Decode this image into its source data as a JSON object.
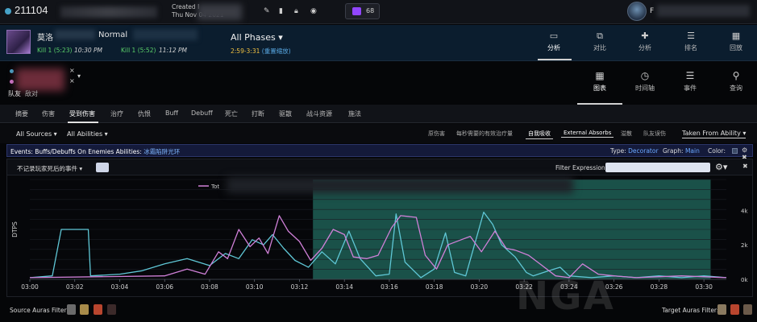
{
  "header": {
    "report_id": "211104",
    "created_label": "Created l",
    "created_date": "Thu Nov 04 2021",
    "twitch_count": "68",
    "user_initial": "F",
    "icons": [
      "pencil-icon",
      "trash-icon",
      "lock-icon",
      "eye-slash-icon",
      "twitch-icon"
    ]
  },
  "boss": {
    "name": "莫洛",
    "difficulty": "Normal",
    "kill_left": "Kill 1 (5:23)",
    "kill_left_time": "10:30 PM",
    "kill_right": "Kill 1 (5:52)",
    "kill_right_time": "11:12 PM",
    "phases_label": "All Phases",
    "phase_range": "2:59-3:31",
    "phase_link": "(重置缩放)"
  },
  "main_nav": [
    {
      "label": "分析",
      "icon": "analysis-icon",
      "active": true
    },
    {
      "label": "对比",
      "icon": "compare-icon",
      "active": false
    },
    {
      "label": "分析",
      "icon": "puzzle-icon",
      "active": false
    },
    {
      "label": "排名",
      "icon": "ranking-icon",
      "active": false
    },
    {
      "label": "回放",
      "icon": "replay-icon",
      "active": false
    }
  ],
  "friendly": {
    "tab_friend": "队友",
    "tab_enemy": "敌对",
    "x1": "×",
    "x2": "×",
    "chevron": "▾"
  },
  "views": [
    {
      "label": "图表",
      "icon": "table-icon",
      "active": true
    },
    {
      "label": "时间轴",
      "icon": "clock-icon",
      "active": false
    },
    {
      "label": "事件",
      "icon": "list-icon",
      "active": false
    },
    {
      "label": "查询",
      "icon": "search-icon",
      "active": false
    }
  ],
  "tabs": [
    {
      "label": "摘要",
      "active": false
    },
    {
      "label": "伤害",
      "active": false
    },
    {
      "label": "受到伤害",
      "active": true
    },
    {
      "label": "治疗",
      "active": false
    },
    {
      "label": "仇恨",
      "active": false
    },
    {
      "label": "Buff",
      "active": false
    },
    {
      "label": "Debuff",
      "active": false
    },
    {
      "label": "死亡",
      "active": false
    },
    {
      "label": "打断",
      "active": false
    },
    {
      "label": "驱散",
      "active": false
    },
    {
      "label": "战斗资源",
      "active": false
    },
    {
      "label": "施法",
      "active": false
    }
  ],
  "filters": {
    "sources": "All Sources ▾",
    "abilities": "All Abilities ▾",
    "options": [
      {
        "label": "原伤害",
        "on": false
      },
      {
        "label": "每秒需要的有效治疗量",
        "on": false
      },
      {
        "label": "自我吸收",
        "on": true
      },
      {
        "label": "External Absorbs",
        "on": true
      },
      {
        "label": "溢散",
        "on": false
      },
      {
        "label": "队友误伤",
        "on": false
      }
    ],
    "taken": "Taken From Ability ▾"
  },
  "events_bar": {
    "label": "Events: Buffs/Debuffs On Enemies",
    "abilities_label": "Abilities:",
    "abilities_value": "冰霜陷阱光环",
    "type_label": "Type:",
    "type_value": "Decorator",
    "graph_label": "Graph:",
    "graph_value": "Main",
    "color_label": "Color:",
    "icons": "⚙ ✖"
  },
  "panel": {
    "dead_filter": "不记录玩家死后的事件 ▾",
    "filter_expression_label": "Filter Expression:",
    "filter_expression_value": "",
    "gear": "⚙▾",
    "close": "✖"
  },
  "chart_data": {
    "type": "line",
    "ylabel": "DTPS",
    "legend": [
      {
        "name": "Tot",
        "color": "#d080d8"
      }
    ],
    "x_ticks": [
      "03:00",
      "03:02",
      "03:04",
      "03:06",
      "03:08",
      "03:10",
      "03:12",
      "03:14",
      "03:16",
      "03:18",
      "03:20",
      "03:22",
      "03:24",
      "03:26",
      "03:28",
      "03:30"
    ],
    "y_ticks": [
      "0k",
      "2k",
      "4k"
    ],
    "xlim": [
      180,
      211
    ],
    "ylim": [
      0,
      5.8
    ],
    "highlight": {
      "start": 192.6,
      "end": 210.3,
      "color": "#1f5e55"
    },
    "series": [
      {
        "color": "#5fc7d6",
        "points": [
          [
            180,
            0.1
          ],
          [
            181,
            0.2
          ],
          [
            181.4,
            2.9
          ],
          [
            182.6,
            2.9
          ],
          [
            182.7,
            0.2
          ],
          [
            184,
            0.3
          ],
          [
            185,
            0.5
          ],
          [
            186,
            0.9
          ],
          [
            187,
            1.2
          ],
          [
            188,
            0.8
          ],
          [
            188.7,
            1.5
          ],
          [
            189.3,
            1.2
          ],
          [
            189.9,
            2.3
          ],
          [
            190.4,
            2.0
          ],
          [
            190.8,
            2.6
          ],
          [
            191.3,
            1.8
          ],
          [
            191.8,
            1.1
          ],
          [
            192.4,
            0.7
          ],
          [
            193,
            1.6
          ],
          [
            193.6,
            0.9
          ],
          [
            194.2,
            2.8
          ],
          [
            194.7,
            1.2
          ],
          [
            195.4,
            0.2
          ],
          [
            196,
            0.3
          ],
          [
            196.3,
            3.8
          ],
          [
            196.7,
            1.0
          ],
          [
            197.4,
            0.1
          ],
          [
            198,
            0.6
          ],
          [
            198.5,
            2.7
          ],
          [
            198.9,
            0.4
          ],
          [
            199.4,
            0.2
          ],
          [
            200.2,
            3.9
          ],
          [
            200.6,
            3.2
          ],
          [
            201,
            2.0
          ],
          [
            201.6,
            1.3
          ],
          [
            202.1,
            0.4
          ],
          [
            202.4,
            0.2
          ],
          [
            203.1,
            0.5
          ],
          [
            203.6,
            0.7
          ],
          [
            204,
            0.2
          ],
          [
            205,
            0.1
          ],
          [
            206,
            0.2
          ],
          [
            207,
            0.1
          ],
          [
            208,
            0.2
          ],
          [
            209,
            0.1
          ],
          [
            210,
            0.2
          ],
          [
            211,
            0.1
          ]
        ]
      },
      {
        "color": "#d080d8",
        "points": [
          [
            180,
            0.1
          ],
          [
            186,
            0.2
          ],
          [
            187,
            0.6
          ],
          [
            187.8,
            0.3
          ],
          [
            188.4,
            1.6
          ],
          [
            188.8,
            1.2
          ],
          [
            189.3,
            2.9
          ],
          [
            189.8,
            1.9
          ],
          [
            190.2,
            2.4
          ],
          [
            190.6,
            1.5
          ],
          [
            191.1,
            3.7
          ],
          [
            191.5,
            2.8
          ],
          [
            192,
            2.2
          ],
          [
            192.5,
            1.1
          ],
          [
            193,
            1.8
          ],
          [
            193.5,
            2.9
          ],
          [
            194,
            2.6
          ],
          [
            194.4,
            1.3
          ],
          [
            195,
            1.2
          ],
          [
            195.5,
            1.4
          ],
          [
            196.1,
            3.0
          ],
          [
            196.5,
            3.7
          ],
          [
            197.2,
            3.6
          ],
          [
            197.6,
            1.4
          ],
          [
            198.1,
            0.6
          ],
          [
            198.6,
            2.0
          ],
          [
            199.2,
            2.3
          ],
          [
            199.6,
            2.5
          ],
          [
            200.1,
            1.6
          ],
          [
            200.7,
            2.8
          ],
          [
            201.2,
            1.8
          ],
          [
            201.6,
            1.7
          ],
          [
            202.2,
            1.4
          ],
          [
            202.8,
            0.8
          ],
          [
            203.4,
            0.2
          ],
          [
            204,
            0.1
          ],
          [
            204.6,
            0.9
          ],
          [
            205.3,
            0.3
          ],
          [
            206,
            0.2
          ],
          [
            207,
            0.1
          ],
          [
            209,
            0.2
          ],
          [
            211,
            0.1
          ]
        ]
      }
    ]
  },
  "bottom": {
    "source_label": "Source Auras Filter:",
    "target_label": "Target Auras Filter:",
    "watermark": "NGA"
  }
}
